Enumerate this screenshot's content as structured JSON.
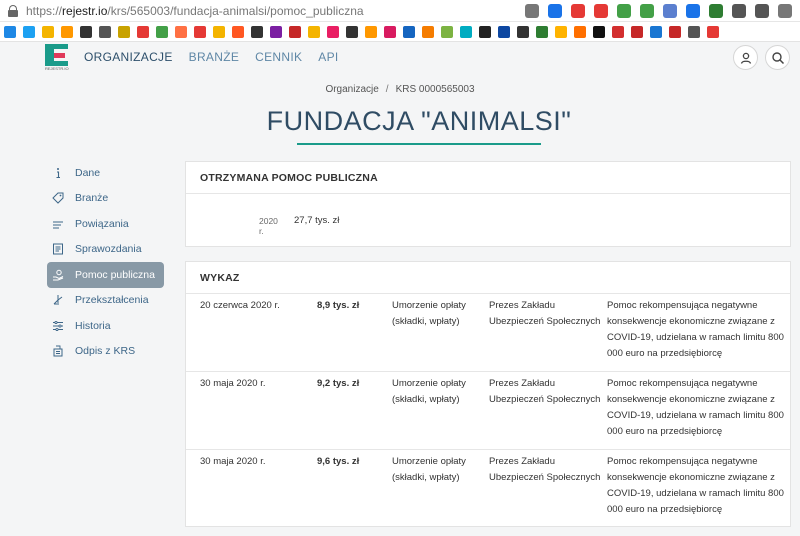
{
  "browser": {
    "url_prefix": "https://",
    "url_host": "rejestr.io",
    "url_path": "/krs/565003/fundacja-animalsi/pomoc_publiczna",
    "extension_colors": [
      "#777777",
      "#1a73e8",
      "#e53935",
      "#e53935",
      "#43a047",
      "#43a047",
      "#5b7fcf",
      "#1a73e8",
      "#2e7d32",
      "#555555",
      "#555555",
      "#777777"
    ],
    "bookmark_colors": [
      "#1e88e5",
      "#1da1f2",
      "#f4b400",
      "#ff9800",
      "#333333",
      "#555555",
      "#c8a200",
      "#e53935",
      "#43a047",
      "#ff7043",
      "#e53935",
      "#f4b400",
      "#ff5722",
      "#333333",
      "#7b1fa2",
      "#c62828",
      "#f4b400",
      "#e91e63",
      "#333333",
      "#ff9800",
      "#d81b60",
      "#1565c0",
      "#f57c00",
      "#7cb342",
      "#00acc1",
      "#222222",
      "#0d47a1",
      "#333333",
      "#2e7d32",
      "#ffb300",
      "#ff6f00",
      "#111111",
      "#d32f2f",
      "#c62828",
      "#1976d2",
      "#c62828",
      "#555555",
      "#e53935"
    ]
  },
  "header": {
    "nav": [
      "ORGANIZACJE",
      "BRANŻE",
      "CENNIK",
      "API"
    ],
    "logo_text": "REJESTR.IO"
  },
  "breadcrumb": {
    "root": "Organizacje",
    "separator": "/",
    "current": "KRS 0000565003"
  },
  "page_title": "FUNDACJA \"ANIMALSI\"",
  "sidebar": {
    "items": [
      {
        "label": "Dane",
        "icon": "info-icon"
      },
      {
        "label": "Branże",
        "icon": "tag-icon"
      },
      {
        "label": "Powiązania",
        "icon": "links-icon"
      },
      {
        "label": "Sprawozdania",
        "icon": "document-icon"
      },
      {
        "label": "Pomoc publiczna",
        "icon": "hand-coin-icon",
        "active": true
      },
      {
        "label": "Przekształcenia",
        "icon": "transform-icon"
      },
      {
        "label": "Historia",
        "icon": "history-icon"
      },
      {
        "label": "Odpis z KRS",
        "icon": "extract-icon"
      }
    ]
  },
  "aid_card": {
    "title": "OTRZYMANA POMOC PUBLICZNA",
    "year": "2020 r.",
    "amount": "27,7 tys. zł"
  },
  "list_card": {
    "title": "WYKAZ",
    "rows": [
      {
        "date": "20 czerwca 2020 r.",
        "amount": "8,9 tys. zł",
        "form": "Umorzenie opłaty (składki, wpłaty)",
        "institution": "Prezes Zakładu Ubezpieczeń Społecznych",
        "description": "Pomoc rekompensująca negatywne konsekwencje ekonomiczne związane z COVID-19, udzielana w ramach limitu 800 000 euro na przedsiębiorcę"
      },
      {
        "date": "30 maja 2020 r.",
        "amount": "9,2 tys. zł",
        "form": "Umorzenie opłaty (składki, wpłaty)",
        "institution": "Prezes Zakładu Ubezpieczeń Społecznych",
        "description": "Pomoc rekompensująca negatywne konsekwencje ekonomiczne związane z COVID-19, udzielana w ramach limitu 800 000 euro na przedsiębiorcę"
      },
      {
        "date": "30 maja 2020 r.",
        "amount": "9,6 tys. zł",
        "form": "Umorzenie opłaty (składki, wpłaty)",
        "institution": "Prezes Zakładu Ubezpieczeń Społecznych",
        "description": "Pomoc rekompensująca negatywne konsekwencje ekonomiczne związane z COVID-19, udzielana w ramach limitu 800 000 euro na przedsiębiorcę"
      }
    ]
  }
}
